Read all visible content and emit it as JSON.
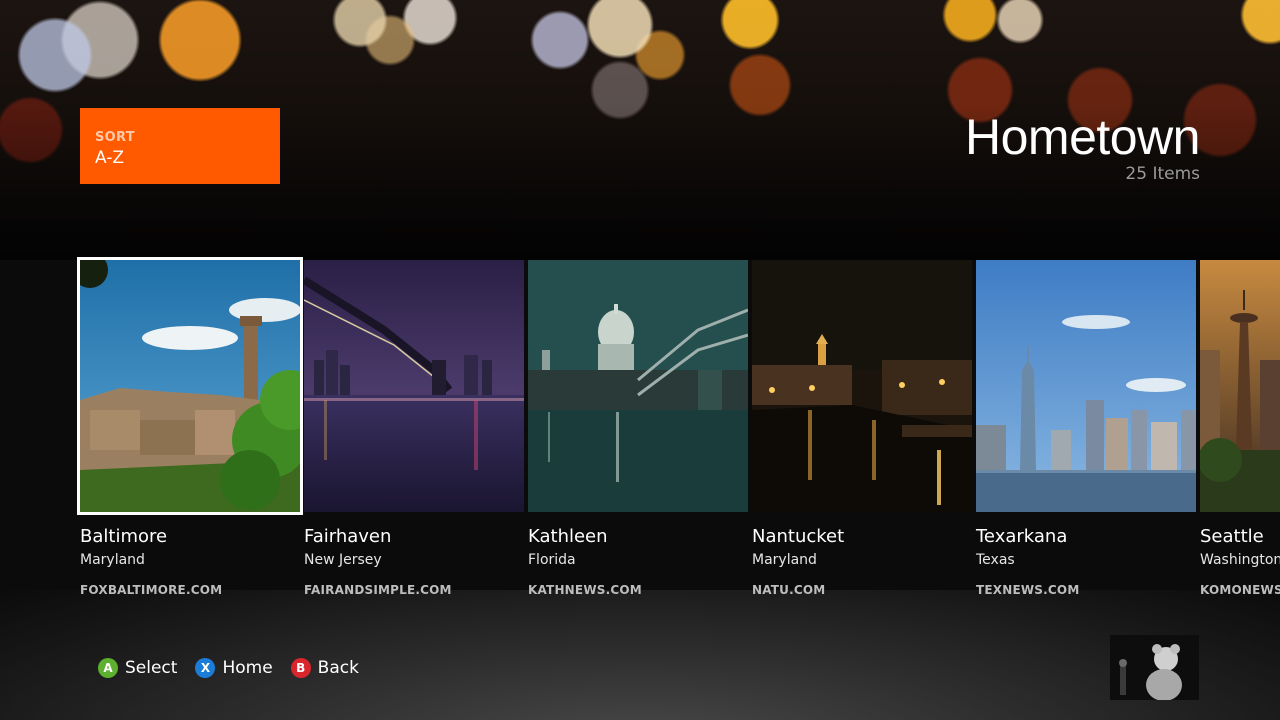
{
  "sort": {
    "label": "SORT",
    "value": "A-Z"
  },
  "header": {
    "title": "Hometown",
    "count": "25 Items"
  },
  "tiles": [
    {
      "name": "Baltimore",
      "state": "Maryland",
      "source": "FOXBALTIMORE.COM",
      "image": "tuscan-hill-town-tower"
    },
    {
      "name": "Fairhaven",
      "state": "New Jersey",
      "source": "FAIRANDSIMPLE.COM",
      "image": "bridge-at-night"
    },
    {
      "name": "Kathleen",
      "state": "Florida",
      "source": "KATHNEWS.COM",
      "image": "dome-cathedral-river-night"
    },
    {
      "name": "Nantucket",
      "state": "Maryland",
      "source": "NATU.COM",
      "image": "canal-town-night"
    },
    {
      "name": "Texarkana",
      "state": "Texas",
      "source": "TEXNEWS.COM",
      "image": "city-skyline-waterfront"
    },
    {
      "name": "Seattle",
      "state": "Washington",
      "source": "KOMONEWS.COM",
      "image": "space-needle-skyline"
    }
  ],
  "hints": [
    {
      "button": "A",
      "label": "Select",
      "color": "#5db12f"
    },
    {
      "button": "X",
      "label": "Home",
      "color": "#1b7dd8"
    },
    {
      "button": "B",
      "label": "Back",
      "color": "#d8262c"
    }
  ],
  "colors": {
    "accent": "#ff5a00",
    "focus": "#ffffff"
  },
  "avatar": {
    "icon": "user-avatar-photo"
  }
}
